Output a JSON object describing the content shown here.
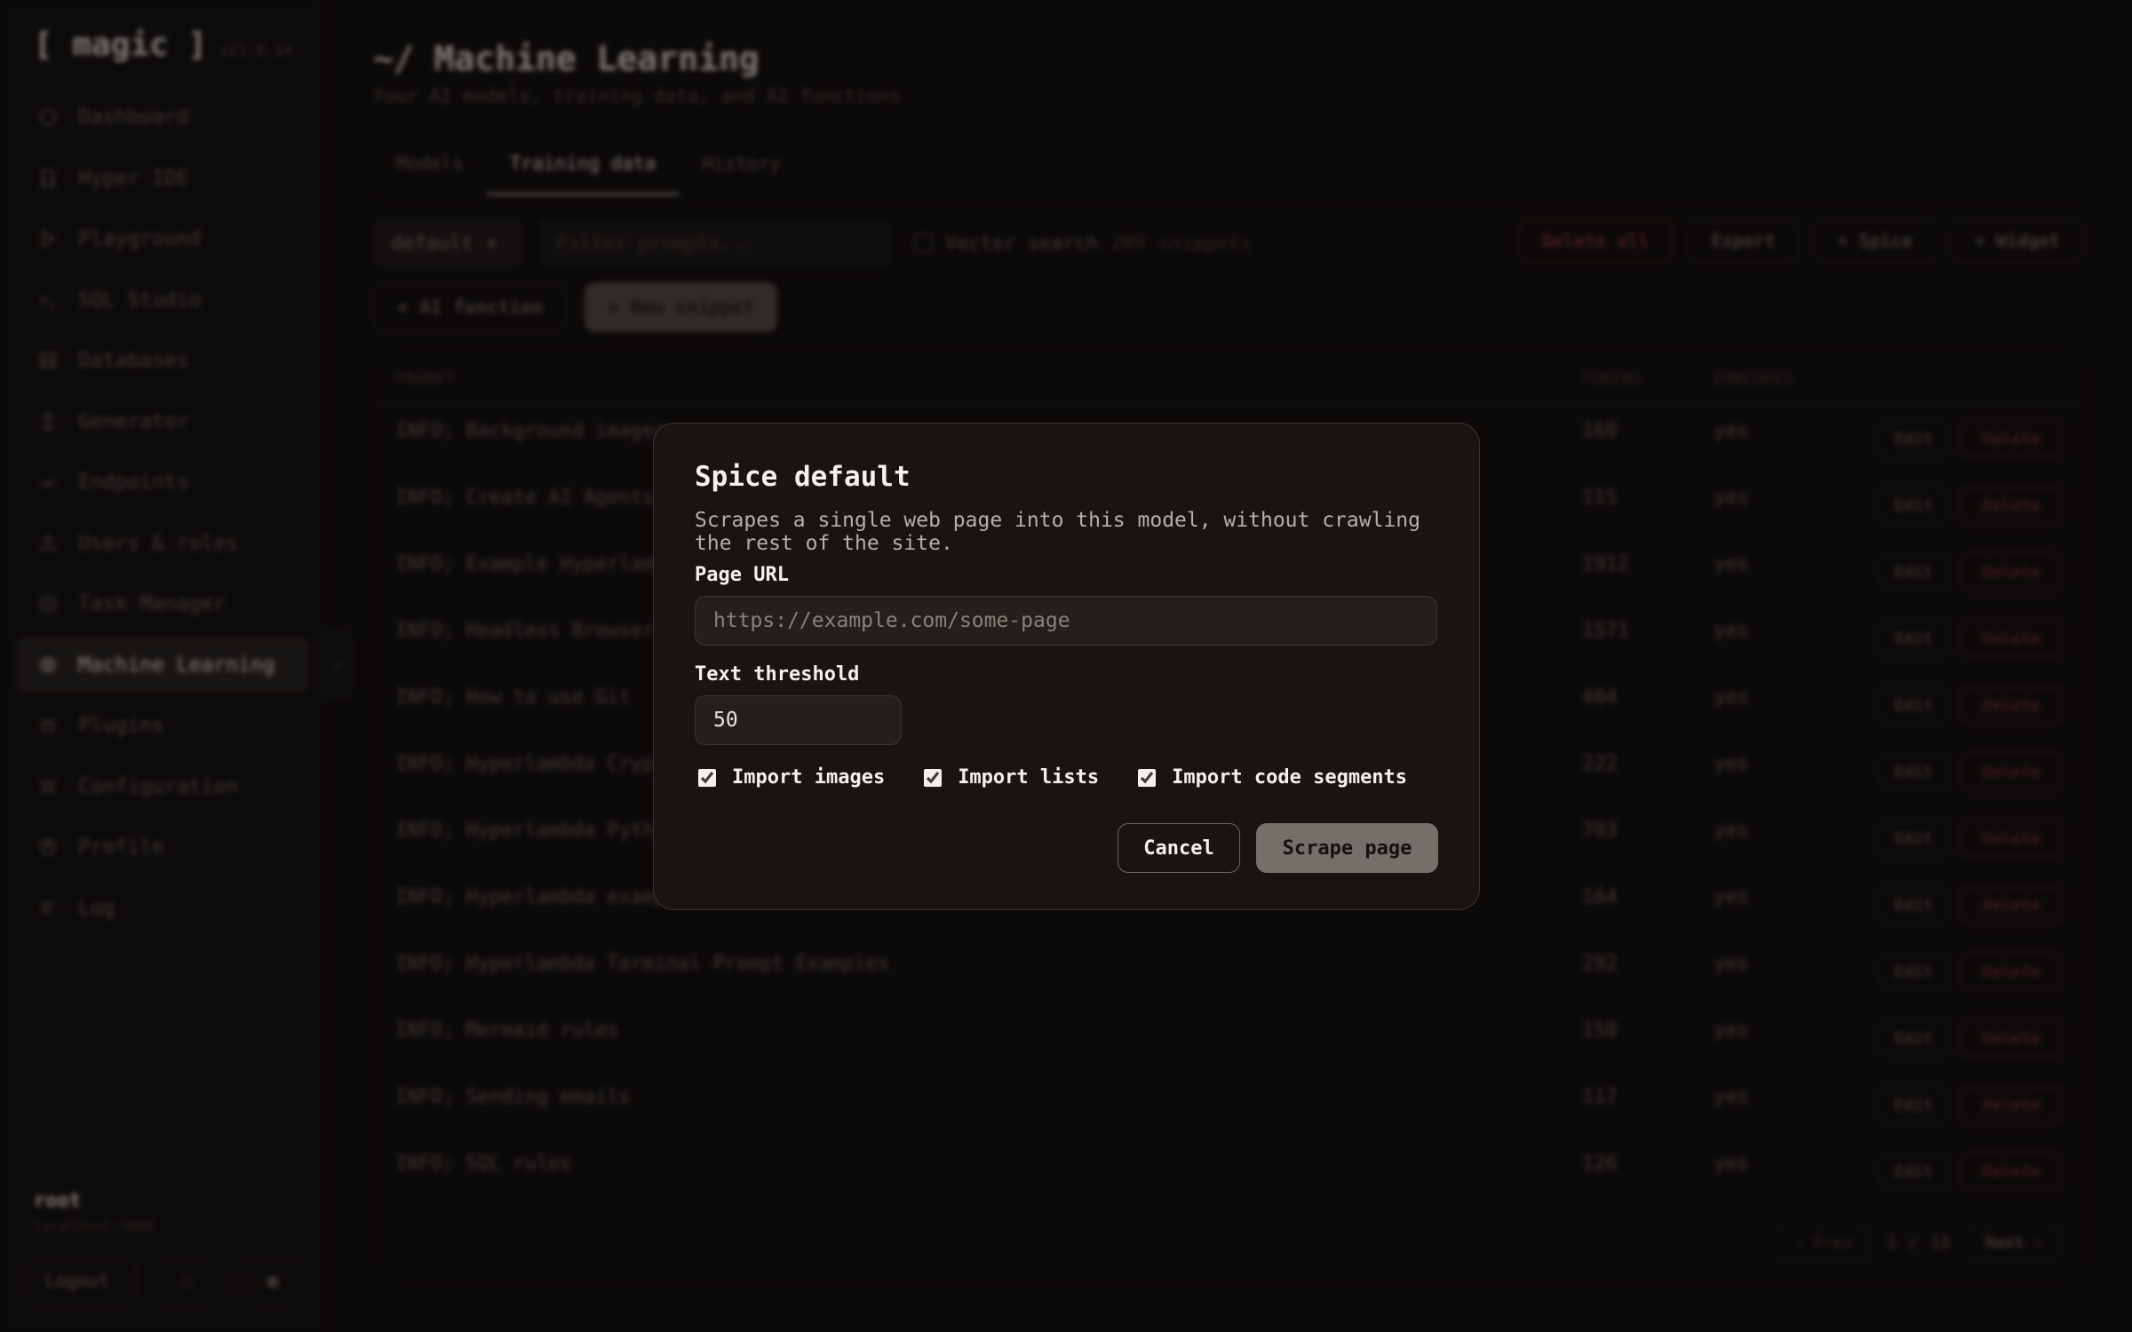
{
  "app": {
    "brand": "[ magic ]",
    "version": "v21.0.14"
  },
  "sidebar": {
    "items": [
      {
        "label": "Dashboard",
        "icon": "dashboard-icon"
      },
      {
        "label": "Hyper IDE",
        "icon": "file-code-icon"
      },
      {
        "label": "Playground",
        "icon": "play-icon"
      },
      {
        "label": "SQL Studio",
        "icon": "terminal-icon"
      },
      {
        "label": "Databases",
        "icon": "database-icon"
      },
      {
        "label": "Generator",
        "icon": "generator-icon"
      },
      {
        "label": "Endpoints",
        "icon": "endpoints-icon"
      },
      {
        "label": "Users & roles",
        "icon": "user-icon"
      },
      {
        "label": "Task Manager",
        "icon": "clock-icon"
      },
      {
        "label": "Machine Learning",
        "icon": "gear-icon",
        "active": true
      },
      {
        "label": "Plugins",
        "icon": "plugin-icon"
      },
      {
        "label": "Configuration",
        "icon": "config-icon"
      },
      {
        "label": "Profile",
        "icon": "profile-icon"
      },
      {
        "label": "Log",
        "icon": "log-icon"
      }
    ],
    "collapse_glyph": "‹",
    "user": {
      "name": "root",
      "host": "localhost:5000"
    },
    "footer": {
      "logout": "Logout",
      "theme_glyph": "◌",
      "settings_glyph": "▣"
    }
  },
  "main": {
    "title": "~/ Machine Learning",
    "subtitle": "Your AI models, training data, and AI functions",
    "tabs": [
      {
        "label": "Models"
      },
      {
        "label": "Training data",
        "active": true
      },
      {
        "label": "History"
      }
    ],
    "toolbar": {
      "model_select": "default",
      "select_caret": "▾",
      "filter_placeholder": "Filter prompts...",
      "vector_search_label": "Vector search",
      "snippet_count": "209 snippets",
      "delete_all": "Delete all",
      "export": "Export",
      "spice": "+ Spice",
      "widget": "+ Widget",
      "ai_function": "+ AI function",
      "new_snippet": "+ New snippet"
    },
    "table": {
      "headers": {
        "prompt": "PROMPT",
        "tokens": "TOKENS",
        "embedded": "EMBEDDED"
      },
      "edit_label": "Edit",
      "delete_label": "Delete",
      "rows": [
        {
          "prompt": "INFO; Background images",
          "tokens": "168",
          "embedded": "yes"
        },
        {
          "prompt": "INFO; Create AI Agents",
          "tokens": "115",
          "embedded": "yes"
        },
        {
          "prompt": "INFO; Example Hyperlambda",
          "tokens": "1912",
          "embedded": "yes"
        },
        {
          "prompt": "INFO; Headless Browser",
          "tokens": "1571",
          "embedded": "yes"
        },
        {
          "prompt": "INFO; How to use Git",
          "tokens": "404",
          "embedded": "yes"
        },
        {
          "prompt": "INFO; Hyperlambda Crypto",
          "tokens": "222",
          "embedded": "yes"
        },
        {
          "prompt": "INFO; Hyperlambda Python",
          "tokens": "703",
          "embedded": "yes"
        },
        {
          "prompt": "INFO; Hyperlambda examples",
          "tokens": "164",
          "embedded": "yes"
        },
        {
          "prompt": "INFO; Hyperlambda Terminal Prompt Examples",
          "tokens": "292",
          "embedded": "yes"
        },
        {
          "prompt": "INFO; Mermaid rules",
          "tokens": "158",
          "embedded": "yes"
        },
        {
          "prompt": "INFO; Sending emails",
          "tokens": "117",
          "embedded": "yes"
        },
        {
          "prompt": "INFO; SQL rules",
          "tokens": "126",
          "embedded": "yes"
        }
      ],
      "pager": {
        "prev": "‹ Prev",
        "page": "1 / 18",
        "next": "Next ›"
      }
    }
  },
  "modal": {
    "title": "Spice default",
    "description": "Scrapes a single web page into this model, without crawling the rest of the site.",
    "url_label": "Page URL",
    "url_value": "",
    "url_placeholder": "https://example.com/some-page",
    "threshold_label": "Text threshold",
    "threshold_value": "50",
    "options": [
      {
        "label": "Import images",
        "checked": true
      },
      {
        "label": "Import lists",
        "checked": true
      },
      {
        "label": "Import code segments",
        "checked": true
      }
    ],
    "cancel": "Cancel",
    "submit": "Scrape page"
  }
}
